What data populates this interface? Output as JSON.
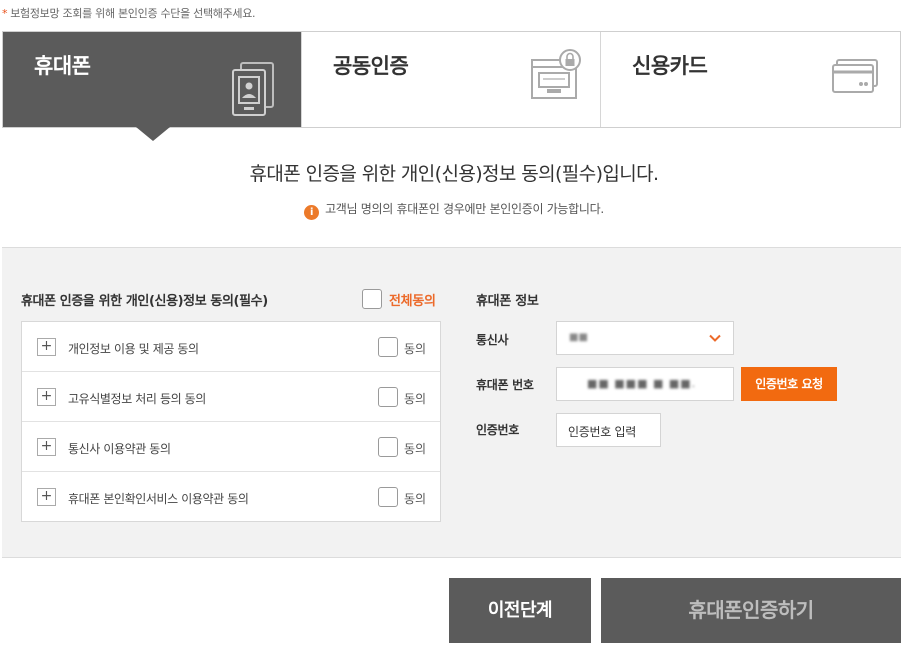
{
  "notice": {
    "star": "*",
    "text": "보험정보망 조회를 위해 본인인증 수단을 선택해주세요."
  },
  "tabs": [
    {
      "label": "휴대폰",
      "icon": "mobile-phone-icon",
      "active": true
    },
    {
      "label": "공동인증",
      "icon": "certificate-lock-icon",
      "active": false
    },
    {
      "label": "신용카드",
      "icon": "credit-card-icon",
      "active": false
    }
  ],
  "heading": "휴대폰 인증을 위한 개인(신용)정보 동의(필수)입니다.",
  "subnote": {
    "icon": "info-icon",
    "icon_glyph": "i",
    "text": "고객님 명의의 휴대폰인 경우에만 본인인증이 가능합니다."
  },
  "agreement": {
    "title": "휴대폰 인증을 위한 개인(신용)정보 동의(필수)",
    "all_label": "전체동의",
    "expand_glyph": "+",
    "agree_word": "동의",
    "items": [
      {
        "label": "개인정보 이용 및 제공 동의"
      },
      {
        "label": "고유식별정보 처리 등의 동의"
      },
      {
        "label": "통신사 이용약관 동의"
      },
      {
        "label": "휴대폰 본인확인서비스 이용약관 동의"
      }
    ]
  },
  "phone_info": {
    "title": "휴대폰 정보",
    "carrier_label": "통신사",
    "carrier_value": "■■",
    "phone_label": "휴대폰 번호",
    "phone_value": "■■ ■■■ ■ ■■.",
    "request_button": "인증번호 요청",
    "code_label": "인증번호",
    "code_placeholder": "인증번호 입력"
  },
  "buttons": {
    "prev": "이전단계",
    "submit": "휴대폰인증하기"
  },
  "colors": {
    "accent": "#f26a10",
    "tab_active": "#5b5b5b",
    "panel": "#f2f2f2"
  }
}
